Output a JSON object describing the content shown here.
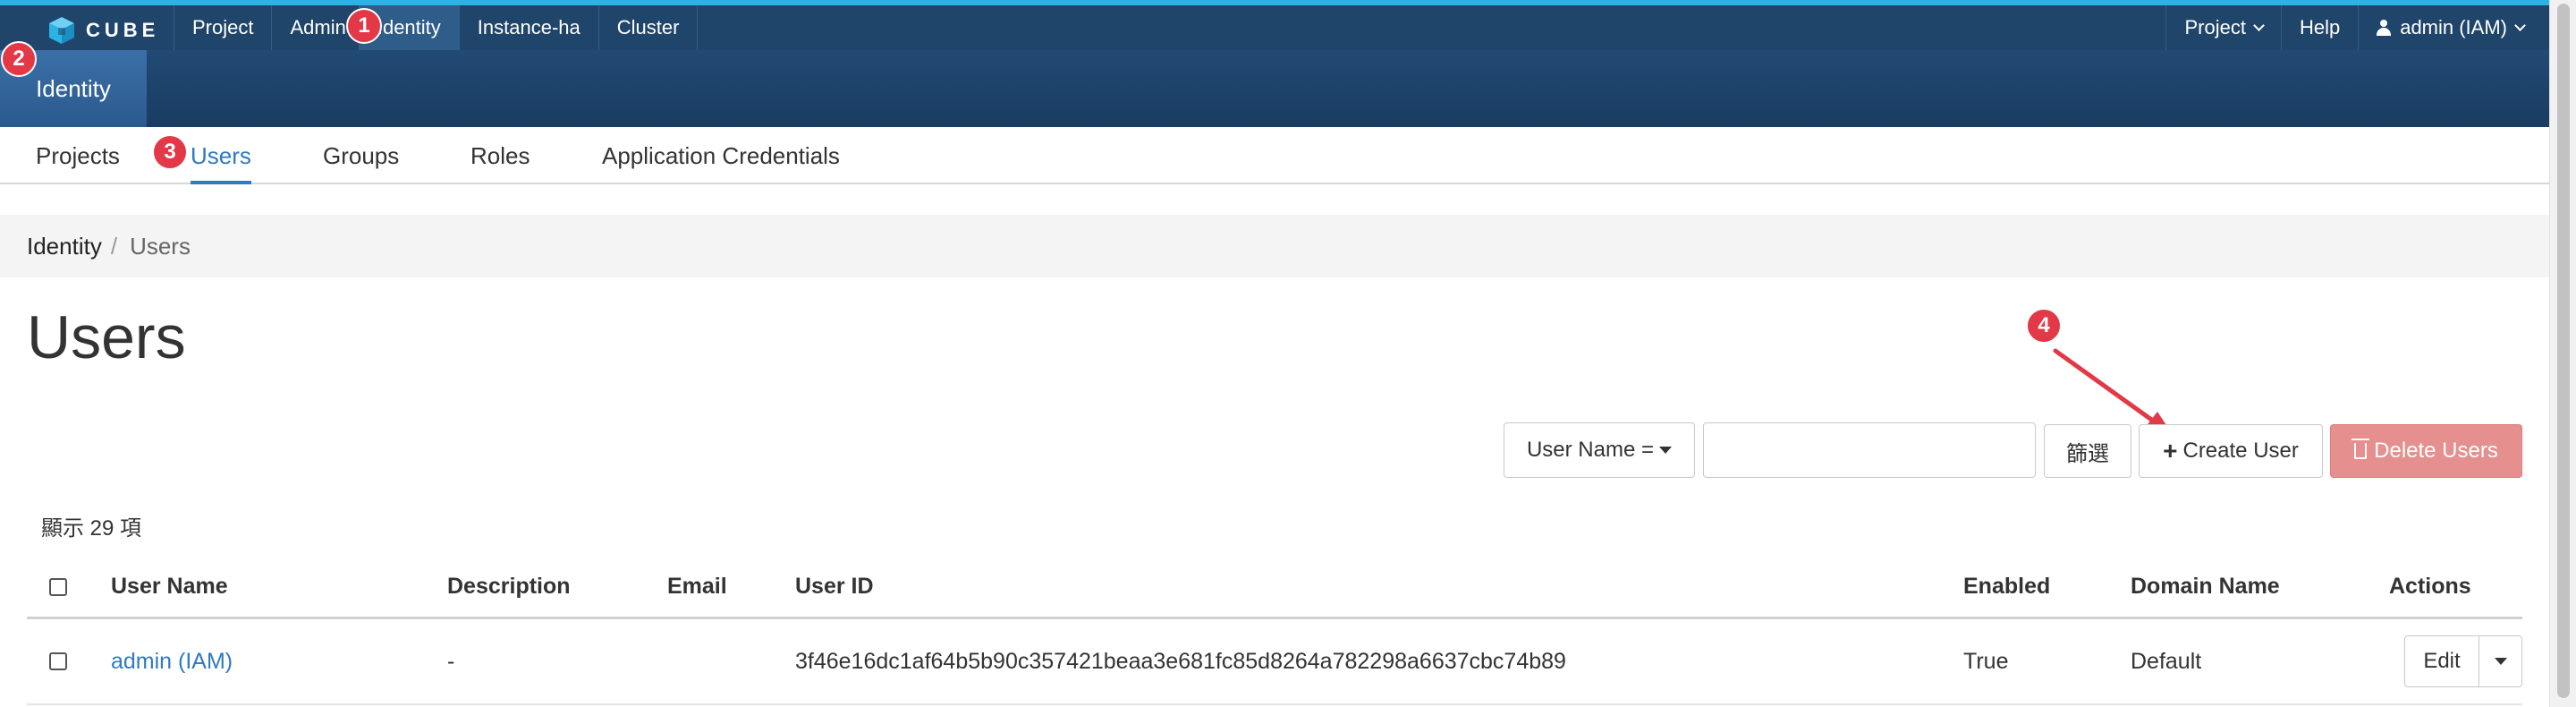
{
  "brand": {
    "name": "CUBE",
    "icon": "cube-logo-icon"
  },
  "topnav": {
    "left": [
      "Project",
      "Admin",
      "Identity",
      "Instance-ha",
      "Cluster"
    ],
    "active": "Identity",
    "right": {
      "project_label": "Project",
      "help_label": "Help",
      "user_label": "admin (IAM)"
    }
  },
  "dashboard": {
    "label": "Identity"
  },
  "panel_tabs": [
    "Projects",
    "Users",
    "Groups",
    "Roles",
    "Application Credentials"
  ],
  "active_panel_tab": "Users",
  "breadcrumb": {
    "parent": "Identity",
    "separator": "/",
    "current": "Users"
  },
  "page": {
    "title": "Users"
  },
  "filter": {
    "field_label": "User Name =",
    "input_value": "",
    "submit_label": "篩選",
    "create_label": "Create User",
    "delete_label": "Delete Users"
  },
  "table": {
    "count_text": "顯示 29 項",
    "headers": [
      "User Name",
      "Description",
      "Email",
      "User ID",
      "Enabled",
      "Domain Name",
      "Actions"
    ],
    "rows": [
      {
        "user_name": "admin (IAM)",
        "description": "-",
        "email": "",
        "user_id": "3f46e16dc1af64b5b90c357421beaa3e681fc85d8264a782298a6637cbc74b89",
        "enabled": "True",
        "domain": "Default",
        "action_label": "Edit"
      }
    ]
  },
  "markers": [
    "1",
    "2",
    "3",
    "4"
  ],
  "colors": {
    "topbar": "#20456a",
    "topbar_accent": "#2cb3e6",
    "link": "#2f7ac2",
    "danger": "#e58f8f",
    "marker": "#e33847"
  }
}
